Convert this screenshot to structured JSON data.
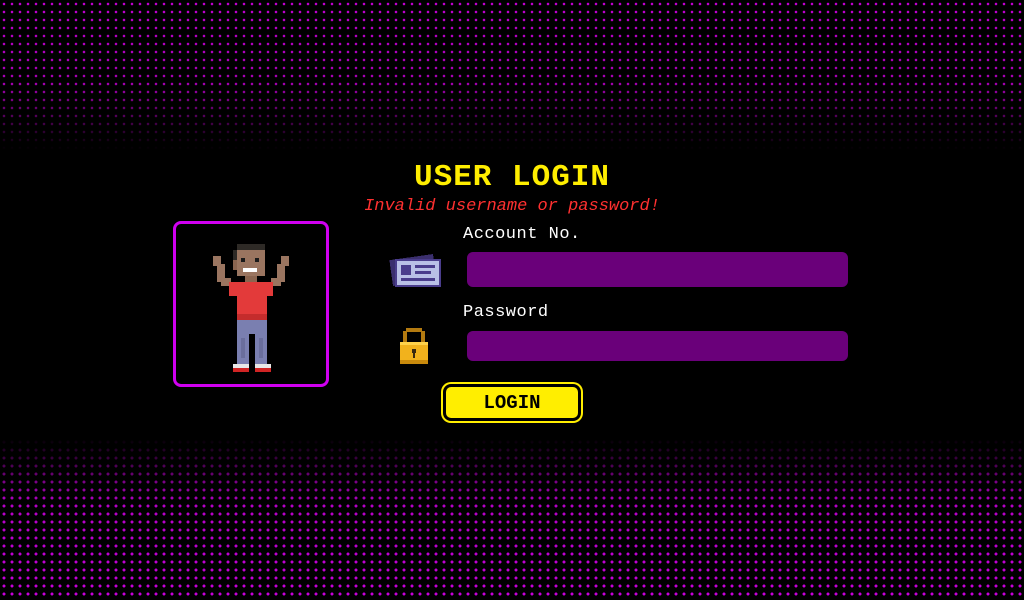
{
  "login": {
    "title": "USER LOGIN",
    "error_message": "Invalid username or password!",
    "account_label": "Account No.",
    "account_value": "",
    "account_placeholder": "",
    "password_label": "Password",
    "password_value": "",
    "password_placeholder": "",
    "button_label": "LOGIN"
  },
  "icons": {
    "avatar": "pixel-character-avatar",
    "account": "id-card-icon",
    "password": "padlock-icon"
  },
  "colors": {
    "background": "#000000",
    "accent": "#d000f0",
    "title": "#ffee00",
    "error": "#ff3030",
    "field": "#6a007a",
    "button": "#ffee00"
  }
}
